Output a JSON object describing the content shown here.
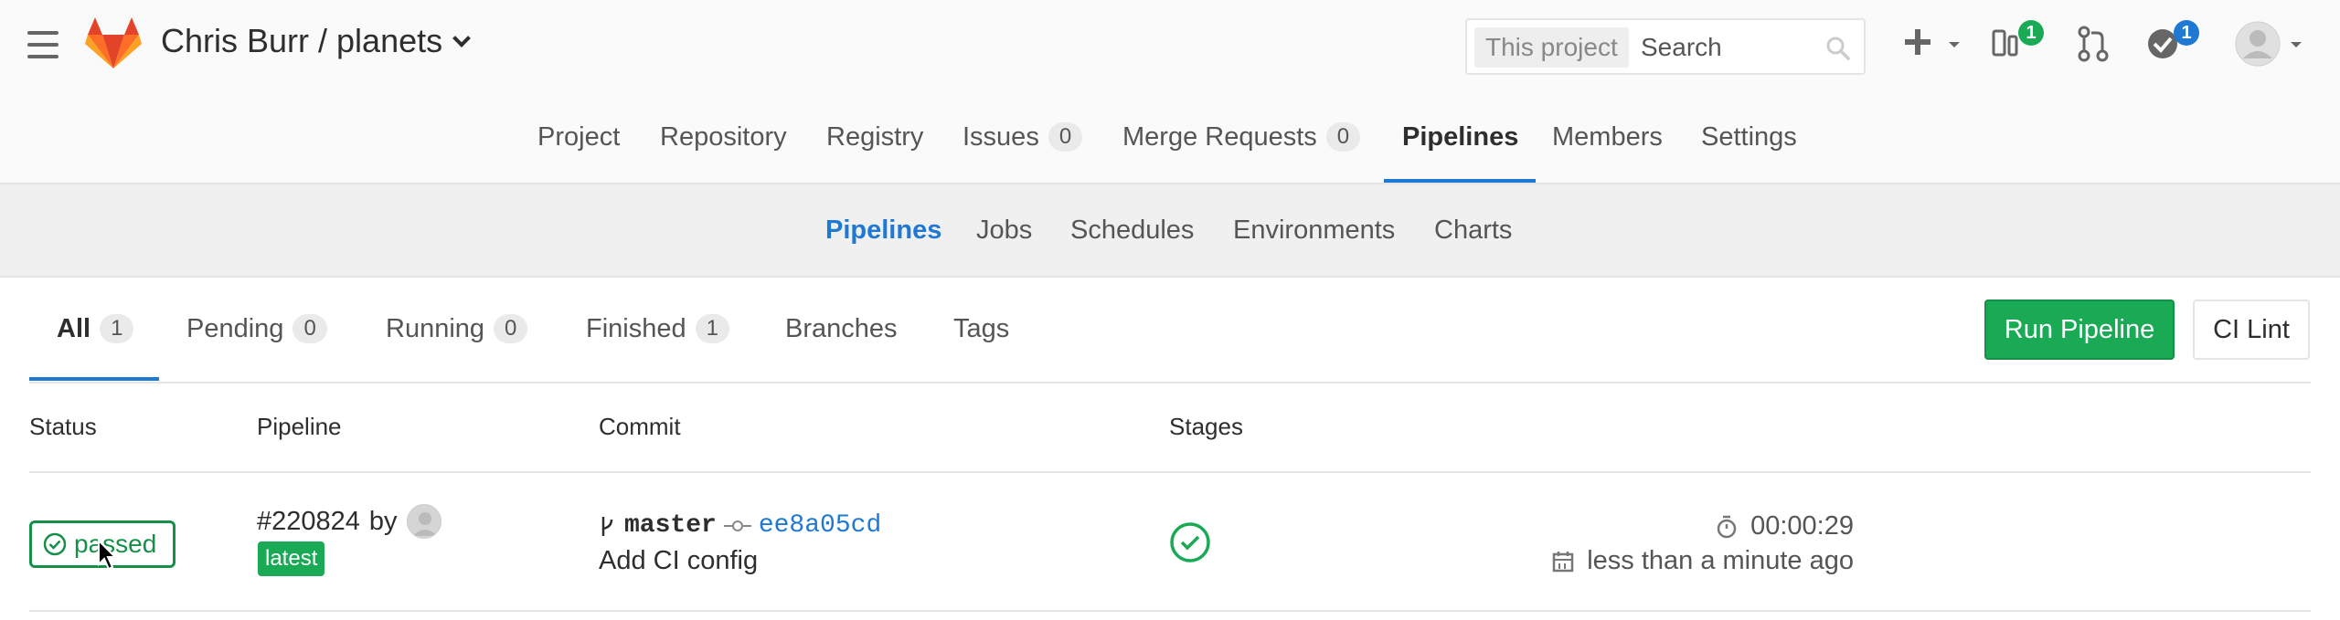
{
  "header": {
    "project_title": "Chris Burr / planets",
    "search_scope": "This project",
    "search_placeholder": "Search",
    "issues_badge": "1",
    "todos_badge": "1"
  },
  "project_nav": {
    "items": [
      {
        "label": "Project"
      },
      {
        "label": "Repository"
      },
      {
        "label": "Registry"
      },
      {
        "label": "Issues",
        "count": "0"
      },
      {
        "label": "Merge Requests",
        "count": "0"
      },
      {
        "label": "Pipelines",
        "active": true
      },
      {
        "label": "Members"
      },
      {
        "label": "Settings"
      }
    ]
  },
  "sub_nav": {
    "items": [
      {
        "label": "Pipelines",
        "active": true
      },
      {
        "label": "Jobs"
      },
      {
        "label": "Schedules"
      },
      {
        "label": "Environments"
      },
      {
        "label": "Charts"
      }
    ]
  },
  "tabs": {
    "items": [
      {
        "label": "All",
        "count": "1",
        "active": true
      },
      {
        "label": "Pending",
        "count": "0"
      },
      {
        "label": "Running",
        "count": "0"
      },
      {
        "label": "Finished",
        "count": "1"
      },
      {
        "label": "Branches"
      },
      {
        "label": "Tags"
      }
    ],
    "run_pipeline_label": "Run Pipeline",
    "ci_lint_label": "CI Lint"
  },
  "table": {
    "headers": {
      "status": "Status",
      "pipeline": "Pipeline",
      "commit": "Commit",
      "stages": "Stages"
    },
    "rows": [
      {
        "status": "passed",
        "pipeline_id": "#220824",
        "by": "by",
        "tag": "latest",
        "branch": "master",
        "sha": "ee8a05cd",
        "commit_title": "Add CI config",
        "duration": "00:00:29",
        "finished": "less than a minute ago"
      }
    ]
  },
  "colors": {
    "accent": "#1f78d1",
    "success": "#1aaa55",
    "success_dark": "#168f48",
    "logo_orange": "#fc6d26"
  }
}
